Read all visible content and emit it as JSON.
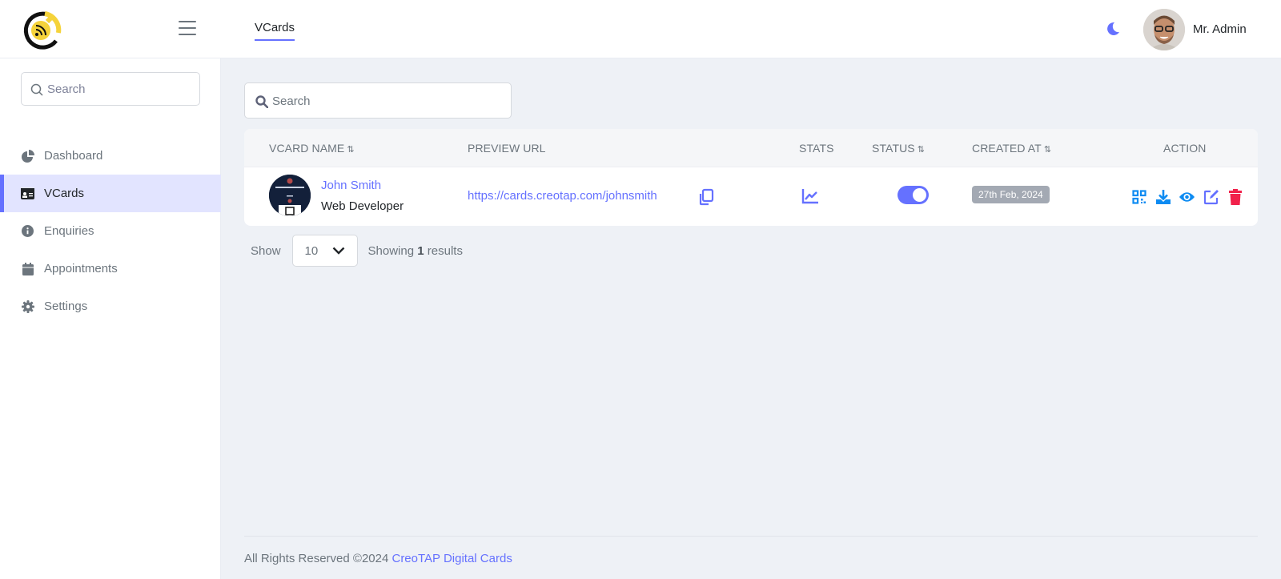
{
  "header": {
    "logo_alt": "CreoTAP logo",
    "active_tab": "VCards",
    "user_name": "Mr. Admin",
    "icons": {
      "menu": "hamburger-icon",
      "theme": "moon-icon"
    }
  },
  "sidebar": {
    "search": {
      "placeholder": "Search",
      "value": ""
    },
    "items": [
      {
        "label": "Dashboard",
        "icon": "pie-chart-icon",
        "active": false
      },
      {
        "label": "VCards",
        "icon": "id-card-icon",
        "active": true
      },
      {
        "label": "Enquiries",
        "icon": "info-circle-icon",
        "active": false
      },
      {
        "label": "Appointments",
        "icon": "calendar-icon",
        "active": false
      },
      {
        "label": "Settings",
        "icon": "gear-icon",
        "active": false
      }
    ]
  },
  "main": {
    "search": {
      "placeholder": "Search",
      "value": ""
    },
    "table": {
      "columns": [
        {
          "label": "VCARD NAME",
          "sortable": true
        },
        {
          "label": "PREVIEW URL",
          "sortable": false
        },
        {
          "label": "STATS",
          "sortable": false
        },
        {
          "label": "STATUS",
          "sortable": true
        },
        {
          "label": "CREATED AT",
          "sortable": true
        },
        {
          "label": "ACTION",
          "sortable": false
        }
      ],
      "sort_glyph": "⇅",
      "rows": [
        {
          "name": "John Smith",
          "role": "Web Developer",
          "preview_url": "https://cards.creotap.com/johnsmith",
          "status_enabled": true,
          "created_at": "27th Feb, 2024",
          "actions": [
            "qr-code",
            "download",
            "view",
            "edit",
            "delete"
          ]
        }
      ]
    },
    "pagination": {
      "show_label": "Show",
      "per_page": "10",
      "showing_prefix": "Showing",
      "result_count": "1",
      "showing_suffix": "results"
    }
  },
  "footer": {
    "text": "All Rights Reserved ©2024",
    "link_text": "CreoTAP Digital Cards"
  },
  "colors": {
    "accent": "#6571ff",
    "action_blue": "#0d8bf2",
    "danger": "#f1214b",
    "badge_gray": "#a3a9b3",
    "logo_yellow": "#f5d33b"
  }
}
